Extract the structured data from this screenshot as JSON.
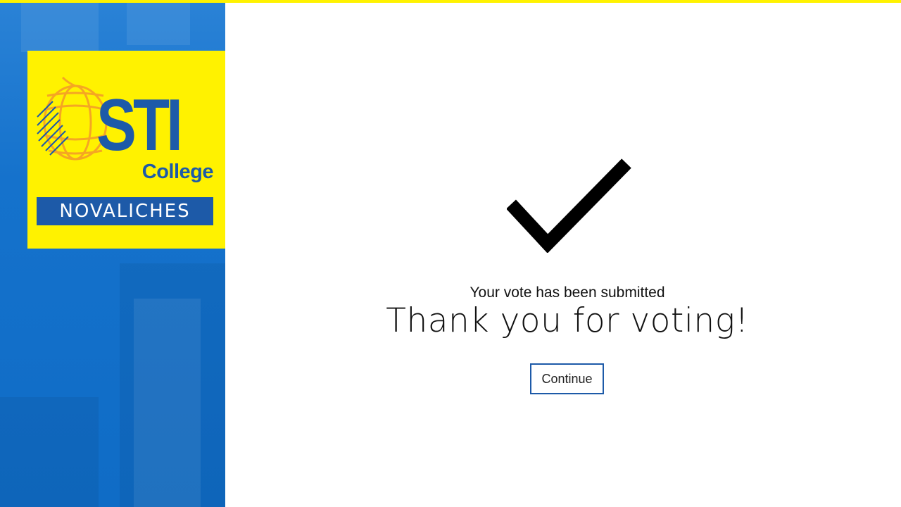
{
  "branding": {
    "logo_text": "STI",
    "logo_subtext": "College",
    "campus": "NOVALICHES",
    "primary_color": "#1d5aa8",
    "accent_color": "#fff200"
  },
  "confirmation": {
    "icon": "checkmark-icon",
    "subtitle": "Your vote has been submitted",
    "headline": "Thank you for voting!",
    "continue_label": "Continue"
  }
}
